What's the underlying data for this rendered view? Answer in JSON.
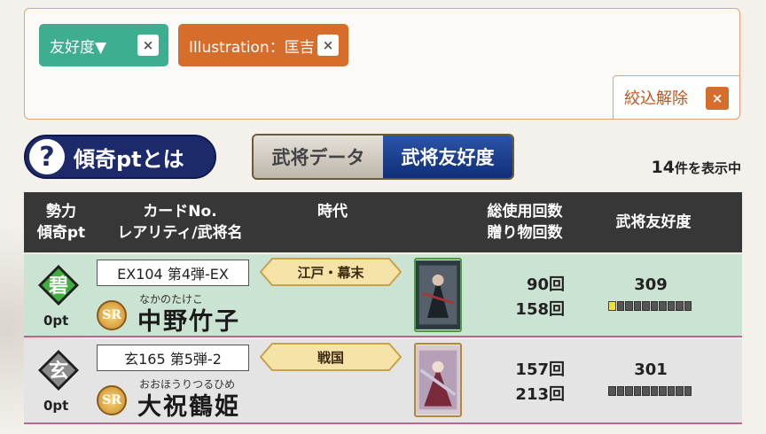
{
  "filters": {
    "chip1_label": "友好度▼",
    "chip2_label": "Illustration：匡吉",
    "chip_close": "×",
    "clear_label": "絞込解除",
    "clear_close": "×"
  },
  "help": {
    "q_glyph": "?",
    "label": "傾奇ptとは"
  },
  "tabs": [
    {
      "label": "武将データ",
      "active": false
    },
    {
      "label": "武将友好度",
      "active": true
    }
  ],
  "count": {
    "number": "14",
    "suffix": "件を表示中"
  },
  "columns": {
    "c1_line1": "勢力",
    "c1_line2": "傾奇pt",
    "c2_line1": "カードNo.",
    "c2_line2": "レアリティ/武将名",
    "c3": "時代",
    "c4_line1": "総使用回数",
    "c4_line2": "贈り物回数",
    "c5": "武将友好度"
  },
  "rows": [
    {
      "faction_glyph": "碧",
      "faction_color": "#2e8a2e",
      "pt": "0pt",
      "card_no": "EX104 第4弾-EX",
      "rarity": "SR",
      "ruby": "なかのたけこ",
      "name": "中野竹子",
      "era": "江戸・幕末",
      "uses": "90回",
      "gifts": "158回",
      "affinity": "309",
      "affinity_level_segments": 1,
      "affinity_total_segments": 10
    },
    {
      "faction_glyph": "玄",
      "faction_color": "#555555",
      "pt": "0pt",
      "card_no": "玄165 第5弾-2",
      "rarity": "SR",
      "ruby": "おおほうりつるひめ",
      "name": "大祝鶴姫",
      "era": "戦国",
      "uses": "157回",
      "gifts": "213回",
      "affinity": "301",
      "affinity_level_segments": 0,
      "affinity_total_segments": 10
    }
  ]
}
